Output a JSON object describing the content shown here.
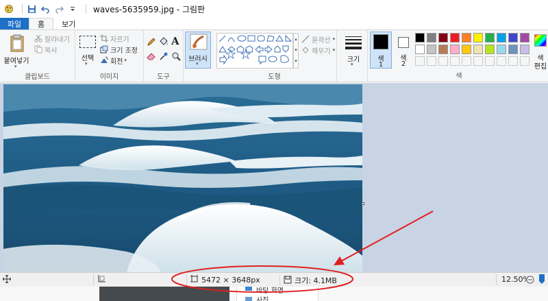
{
  "titlebar": {
    "title": "waves-5635959.jpg - 그림판",
    "icons": [
      "paint-app-icon",
      "save-icon",
      "undo-icon",
      "redo-icon",
      "customize-dropdown-icon"
    ]
  },
  "tabs": [
    {
      "label": "파일"
    },
    {
      "label": "홈"
    },
    {
      "label": "보기"
    }
  ],
  "ribbon": {
    "clipboard": {
      "paste_label": "붙여넣기",
      "cut_label": "잘라내기",
      "copy_label": "복사",
      "group_label": "클립보드"
    },
    "image": {
      "select_label": "선택",
      "crop_label": "자르기",
      "resize_label": "크기 조정",
      "rotate_label": "회전",
      "group_label": "이미지"
    },
    "tools": {
      "group_label": "도구",
      "text_tool": "A"
    },
    "brush": {
      "label": "브러시"
    },
    "shapes": {
      "outline_label": "윤곽선",
      "fill_label": "채우기",
      "group_label": "도형"
    },
    "size": {
      "label": "크기"
    },
    "colors": {
      "color1_label": "색",
      "color1_num": "1",
      "color2_label": "색",
      "color2_num": "2",
      "group_label": "색",
      "edit_label": "색",
      "edit_label2": "편집",
      "color1_value": "#000000",
      "color2_value": "#ffffff",
      "palette_row1": [
        "#000000",
        "#7f7f7f",
        "#880015",
        "#ed1c24",
        "#ff7f27",
        "#fff200",
        "#22b14c",
        "#00a2e8",
        "#3f48cc",
        "#a349a4"
      ],
      "palette_row2": [
        "#ffffff",
        "#c3c3c3",
        "#b97a57",
        "#ffaec9",
        "#ffc90e",
        "#efe4b0",
        "#b5e61d",
        "#99d9ea",
        "#7092be",
        "#c8bfe7"
      ]
    }
  },
  "statusbar": {
    "dimensions": "5472 × 3648px",
    "size": "크기: 4.1MB",
    "zoom": "12.50%"
  },
  "below": {
    "item1": "바탕 화면",
    "item2": "사진"
  }
}
